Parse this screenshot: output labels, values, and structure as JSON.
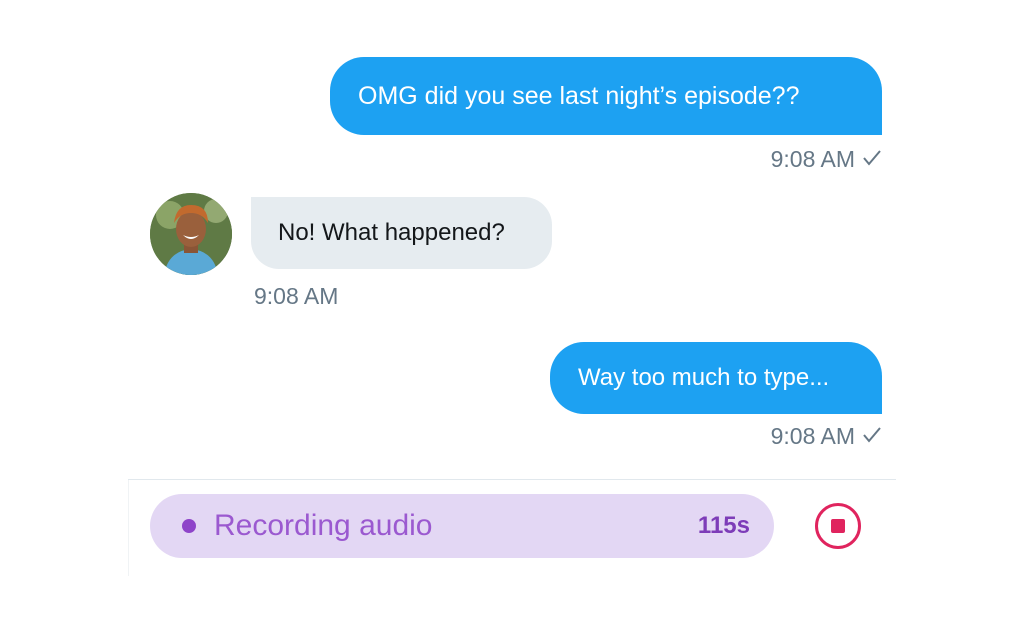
{
  "conversation": {
    "messages": [
      {
        "direction": "outgoing",
        "text": "OMG did you see last night’s episode??",
        "time": "9:08 AM",
        "status_icon": "check-icon"
      },
      {
        "direction": "incoming",
        "text": "No! What happened?",
        "time": "9:08 AM",
        "avatar": "contact-avatar"
      },
      {
        "direction": "outgoing",
        "text": "Way too much to type...",
        "time": "9:08 AM",
        "status_icon": "check-icon"
      }
    ]
  },
  "recorder": {
    "label": "Recording audio",
    "timer": "115s",
    "stop_icon": "stop-icon"
  },
  "colors": {
    "outgoing_bubble": "#1da1f2",
    "incoming_bubble": "#e6ecf0",
    "recorder_bg": "#e3d7f4",
    "recorder_text": "#9b59d0",
    "stop_accent": "#e0245e"
  }
}
